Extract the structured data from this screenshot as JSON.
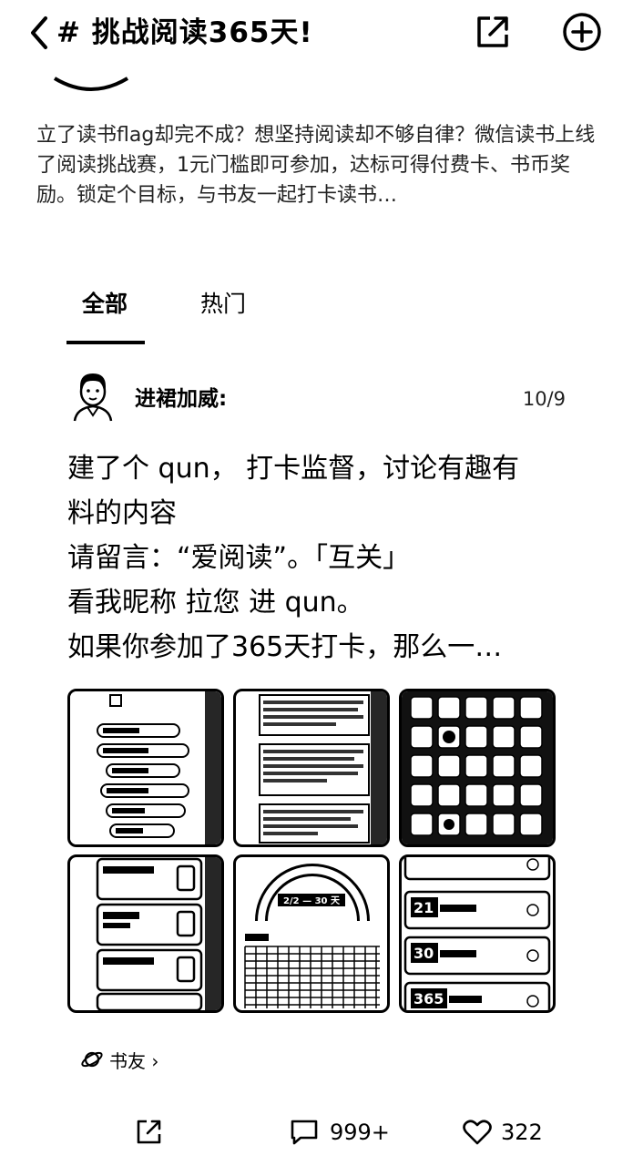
{
  "header": {
    "title": "# 挑战阅读365天!",
    "back_icon": "chevron-left-icon",
    "share_icon": "share-icon",
    "add_icon": "add-circle-icon"
  },
  "topic": {
    "description": "立了读书flag却完不成？想坚持阅读却不够自律？微信读书上线了阅读挑战赛，1元门槛即可参加，达标可得付费卡、书币奖励。锁定个目标，与书友一起打卡读书…"
  },
  "tabs": [
    {
      "label": "全部",
      "active": true
    },
    {
      "label": "热门",
      "active": false
    }
  ],
  "post": {
    "author": "进裙加威:",
    "date": "10/9",
    "body_lines": [
      "建了个 qun， 打卡监督，讨论有趣有",
      "料的内容",
      "请留言：“爱阅读”。「互关」",
      "看我昵称  拉您 进 qun。",
      "如果你参加了365天打卡，那么一…"
    ],
    "thumbnails": {
      "t5_label": "2/2 — 30 天",
      "t6_labels": [
        "21",
        "30",
        "365"
      ]
    },
    "circle_tag": "书友 ›",
    "comment_count": "999+",
    "like_count": "322"
  }
}
